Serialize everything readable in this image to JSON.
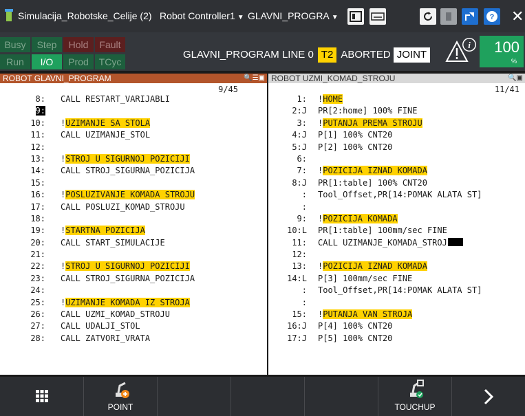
{
  "titlebar": {
    "workcell": "Simulacija_Robotske_Celije (2)",
    "controller": "Robot Controller1",
    "program": "GLAVNI_PROGRA",
    "caret": "▼"
  },
  "status": {
    "lamps": [
      "Busy",
      "Step",
      "Hold",
      "Fault",
      "Run",
      "I/O",
      "Prod",
      "TCyc"
    ],
    "program_name": "GLAVNI_PROGRAM",
    "line_label": "LINE 0",
    "mode": "T2",
    "state": "ABORTED",
    "coord": "JOINT",
    "override": "100",
    "override_unit": "%"
  },
  "left_panel": {
    "title": "ROBOT  GLAVNI_PROGRAM",
    "position": "9/45",
    "lines": [
      {
        "n": "8:",
        "t": "CALL RESTART_VARIJABLI",
        "hl": ""
      },
      {
        "n": "9:",
        "t": "",
        "hl": "",
        "cursor": true
      },
      {
        "n": "10:",
        "t": "!",
        "hl": "UZIMANJE SA STOLA"
      },
      {
        "n": "11:",
        "t": "CALL UZIMANJE_STOL",
        "hl": ""
      },
      {
        "n": "12:",
        "t": "",
        "hl": ""
      },
      {
        "n": "13:",
        "t": "!",
        "hl": "STROJ U SIGURNOJ POZICIJI"
      },
      {
        "n": "14:",
        "t": "CALL STROJ_SIGURNA_POZICIJA",
        "hl": ""
      },
      {
        "n": "15:",
        "t": "",
        "hl": ""
      },
      {
        "n": "16:",
        "t": "!",
        "hl": "POSLUZIVANJE KOMADA STROJU"
      },
      {
        "n": "17:",
        "t": "CALL POSLUZI_KOMAD_STROJU",
        "hl": ""
      },
      {
        "n": "18:",
        "t": "",
        "hl": ""
      },
      {
        "n": "19:",
        "t": "!",
        "hl": "STARTNA POZICIJA"
      },
      {
        "n": "20:",
        "t": "CALL START_SIMULACIJE",
        "hl": ""
      },
      {
        "n": "21:",
        "t": "",
        "hl": ""
      },
      {
        "n": "22:",
        "t": "!",
        "hl": "STROJ U SIGURNOJ POZICIJI"
      },
      {
        "n": "23:",
        "t": "CALL STROJ_SIGURNA_POZICIJA",
        "hl": ""
      },
      {
        "n": "24:",
        "t": "",
        "hl": ""
      },
      {
        "n": "25:",
        "t": "!",
        "hl": "UZIMANJE KOMADA IZ STROJA"
      },
      {
        "n": "26:",
        "t": "CALL UZMI_KOMAD_STROJU",
        "hl": ""
      },
      {
        "n": "27:",
        "t": "CALL UDALJI_STOL",
        "hl": ""
      },
      {
        "n": "28:",
        "t": "CALL ZATVORI_VRATA",
        "hl": ""
      }
    ]
  },
  "right_panel": {
    "title": "ROBOT  UZMI_KOMAD_STROJU",
    "position": "11/41",
    "lines": [
      {
        "n": "1:",
        "t": "!",
        "hl": "HOME"
      },
      {
        "n": "2:J",
        "t": "PR[2:home] 100% FINE",
        "hl": ""
      },
      {
        "n": "3:",
        "t": "!",
        "hl": "PUTANJA PREMA STROJU"
      },
      {
        "n": "4:J",
        "t": "P[1] 100% CNT20",
        "hl": ""
      },
      {
        "n": "5:J",
        "t": "P[2] 100% CNT20",
        "hl": ""
      },
      {
        "n": "6:",
        "t": "",
        "hl": ""
      },
      {
        "n": "7:",
        "t": "!",
        "hl": "POZICIJA IZNAD KOMADA"
      },
      {
        "n": "8:J",
        "t": "PR[1:table] 100% CNT20",
        "hl": ""
      },
      {
        "n": ":",
        "t": "Tool_Offset,PR[14:POMAK ALATA ST]",
        "hl": ""
      },
      {
        "n": ":",
        "t": "",
        "hl": ""
      },
      {
        "n": "9:",
        "t": "!",
        "hl": "POZICIJA KOMADA"
      },
      {
        "n": "10:L",
        "t": "PR[1:table] 100mm/sec FINE",
        "hl": ""
      },
      {
        "n": "11:",
        "t": "CALL UZIMANJE_KOMADA_STROJ",
        "hl": "",
        "endcursor": true
      },
      {
        "n": "12:",
        "t": "",
        "hl": ""
      },
      {
        "n": "13:",
        "t": "!",
        "hl": "POZICIJA IZNAD KOMADA"
      },
      {
        "n": "14:L",
        "t": "P[3] 100mm/sec FINE",
        "hl": ""
      },
      {
        "n": ":",
        "t": "Tool_Offset,PR[14:POMAK ALATA ST]",
        "hl": ""
      },
      {
        "n": ":",
        "t": "",
        "hl": ""
      },
      {
        "n": "15:",
        "t": "!",
        "hl": "PUTANJA VAN STROJA"
      },
      {
        "n": "16:J",
        "t": "P[4] 100% CNT20",
        "hl": ""
      },
      {
        "n": "17:J",
        "t": "P[5] 100% CNT20",
        "hl": ""
      }
    ]
  },
  "bottom": {
    "keys": [
      "",
      "POINT",
      "",
      "",
      "",
      "TOUCHUP",
      ""
    ]
  }
}
